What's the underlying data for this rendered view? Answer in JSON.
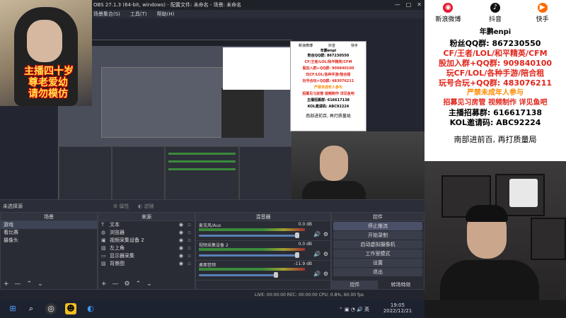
{
  "obs": {
    "title": "OBS 27.1.3 (64-bit, windows) - 配置文件: 未命名 - 场景: 未命名",
    "menu": [
      "场景集合(S)",
      "工具(T)",
      "帮助(H)"
    ],
    "window_controls": [
      "—",
      "□",
      "✕"
    ]
  },
  "overlay": {
    "line1": "主播四十岁",
    "line2": "尊老爱幼",
    "line3": "请勿模仿"
  },
  "ad_small": {
    "socials": [
      "新浪微博",
      "抖音",
      "快手"
    ],
    "handle": "年鹏enpi",
    "lines": [
      "粉丝QQ群: 867230550",
      "CF/王者/LOL/和平精英/CFM",
      "股加入群+QQ群: 909840100",
      "玩CF/LOL/各种手游/陪合租",
      "玩号合玩+QQ群: 483076211",
      "严禁未成年人参与",
      "招募见习房管 视频制作 详见鱼吧",
      "主播招募群: 616617138",
      "KOL邀请码: ABC92224"
    ],
    "footer": "南部进前百, 再打质量局"
  },
  "docks": {
    "status_row_left": "未选择源",
    "properties_btn": "属性",
    "filters_btn": "滤镜",
    "scenes": {
      "title": "场景",
      "items": [
        "游戏",
        "看比赛",
        "摄像头"
      ]
    },
    "sources": {
      "title": "来源",
      "items": [
        {
          "icon": "text-icon",
          "glyph": "T",
          "label": "文本"
        },
        {
          "icon": "browser-icon",
          "glyph": "◍",
          "label": "浏览器"
        },
        {
          "icon": "camera-icon",
          "glyph": "▣",
          "label": "视频采集设备 2"
        },
        {
          "icon": "image-icon",
          "glyph": "▨",
          "label": "左上角"
        },
        {
          "icon": "monitor-icon",
          "glyph": "▭",
          "label": "显示器采集"
        },
        {
          "icon": "image-icon",
          "glyph": "▨",
          "label": "背景图"
        }
      ]
    },
    "mixer": {
      "title": "混音器",
      "channels": [
        {
          "name": "麦克风/Aux",
          "db": "0.0 dB"
        },
        {
          "name": "视频采集设备 2",
          "db": "0.0 dB"
        },
        {
          "name": "桌面音频",
          "db": "-11.9 dB"
        }
      ]
    },
    "controls": {
      "title": "控件",
      "buttons": [
        "停止推流",
        "开始录制",
        "启动虚拟摄像机",
        "工作室模式",
        "设置",
        "退出"
      ],
      "tabs": [
        "控件",
        "转场特效"
      ]
    },
    "footer_glyphs": [
      "+",
      "—",
      "⌃",
      "⌄"
    ],
    "source_footer_glyphs": [
      "+",
      "—",
      "⚙",
      "⌃",
      "⌄"
    ]
  },
  "statusbar": {
    "text": "LIVE: 00:00:00   REC: 00:00:00   CPU: 0.8%, 60.00 fps"
  },
  "taskbar": {
    "lang": "英",
    "time": "19:05",
    "date": "2022/12/21"
  },
  "right_ad": {
    "socials": [
      "新浪微博",
      "抖音",
      "快手"
    ],
    "handle": "年鹏enpi",
    "line1": "粉丝QQ群: 867230550",
    "line2": "CF/王者/LOL/和平精英/CFM",
    "line3": "股加入群+QQ群: 909840100",
    "line4": "玩CF/LOL/各种手游/陪合租",
    "line5": "玩号合玩+QQ群: 483076211",
    "line6": "严禁未成年人参与",
    "line7a": "招募见习房管",
    "line7b": "视频制作",
    "line7c": "详见鱼吧",
    "line8": "主播招募群: 616617138",
    "line9": "KOL邀请码: ABC92224",
    "footer": "南部进前百, 再打质量局"
  },
  "colors": {
    "red": "#e1251b",
    "orange": "#ff8a00",
    "obs_bg": "#2b2e38"
  }
}
